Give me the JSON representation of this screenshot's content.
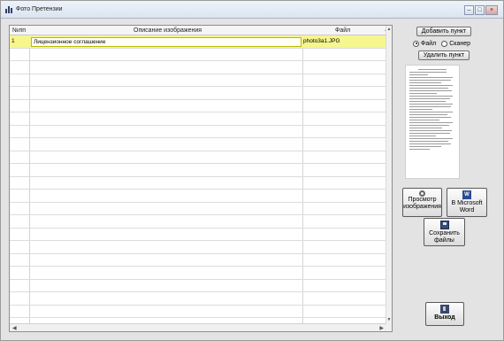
{
  "window": {
    "title": "Фото Претензии",
    "controls": [
      "minimize-icon",
      "maximize-icon",
      "close-icon"
    ]
  },
  "grid": {
    "columns": [
      "№пп",
      "Описание изображения",
      "Файл"
    ],
    "rows": [
      {
        "num": "1",
        "description": "Лицензионное соглашение",
        "file": "photo3a1.JPG",
        "selected": true
      }
    ]
  },
  "side": {
    "add_item": "Добавить пункт",
    "source_options": [
      "Файл",
      "Сканер"
    ],
    "source_selected": "Файл",
    "delete_item": "Удалить пункт",
    "view_image_line1": "Просмотр",
    "view_image_line2": "изображения",
    "to_word_line1": "В Microsoft",
    "to_word_line2": "Word",
    "save_files_line1": "Сохранить",
    "save_files_line2": "файлы",
    "exit": "Выход"
  },
  "colors": {
    "selected_row": "#f6f68f",
    "window_bg": "#e3e3e3"
  }
}
